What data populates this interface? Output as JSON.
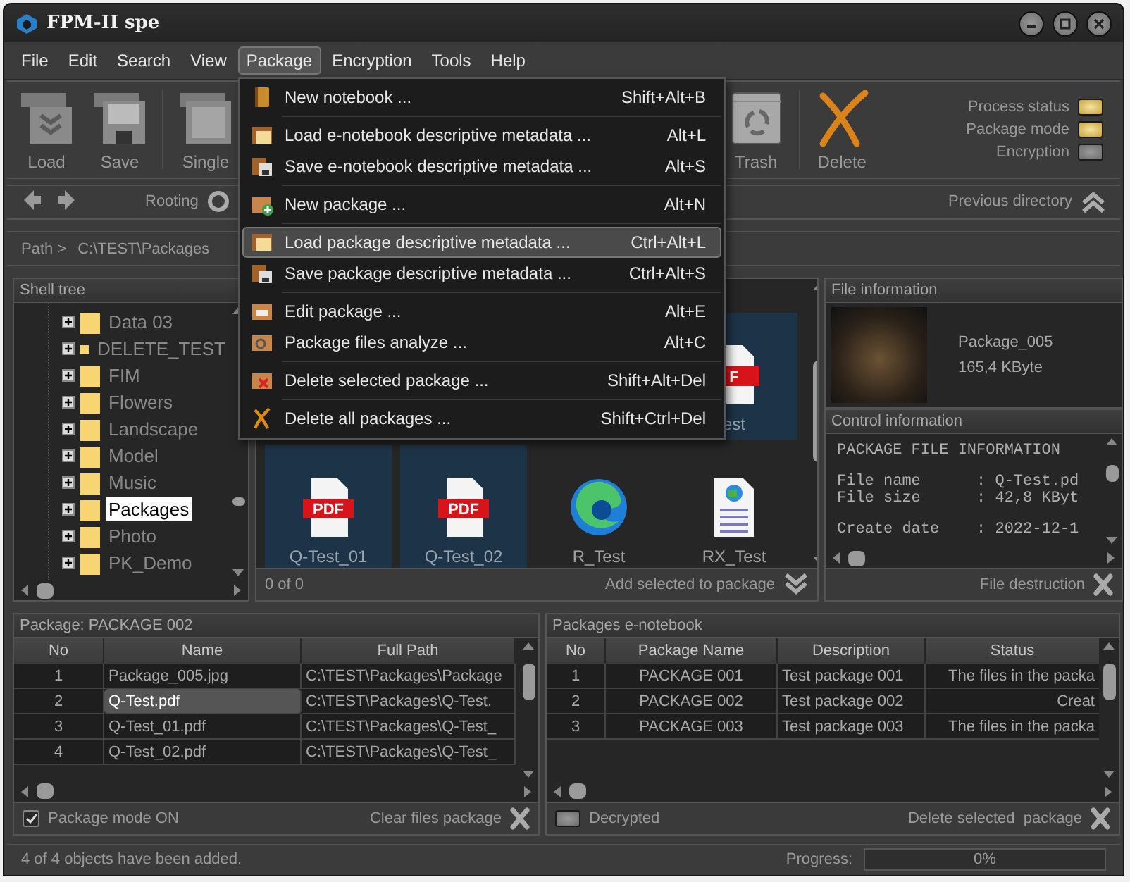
{
  "window": {
    "title": "FPM-II spe"
  },
  "menu_bar": [
    {
      "label": "File",
      "selected": false
    },
    {
      "label": "Edit",
      "selected": false
    },
    {
      "label": "Search",
      "selected": false
    },
    {
      "label": "View",
      "selected": false
    },
    {
      "label": "Package",
      "selected": true
    },
    {
      "label": "Encryption",
      "selected": false
    },
    {
      "label": "Tools",
      "selected": false
    },
    {
      "label": "Help",
      "selected": false
    }
  ],
  "package_menu": [
    {
      "kind": "item",
      "label": "New notebook ...",
      "shortcut": "Shift+Alt+B",
      "selected": false
    },
    {
      "kind": "separator"
    },
    {
      "kind": "item",
      "label": "Load e-notebook descriptive metadata ...",
      "shortcut": "Alt+L",
      "selected": false
    },
    {
      "kind": "item",
      "label": "Save e-notebook descriptive metadata ...",
      "shortcut": "Alt+S",
      "selected": false
    },
    {
      "kind": "separator"
    },
    {
      "kind": "item",
      "label": "New package ...",
      "shortcut": "Alt+N",
      "selected": false
    },
    {
      "kind": "separator"
    },
    {
      "kind": "item",
      "label": "Load package descriptive metadata ...",
      "shortcut": "Ctrl+Alt+L",
      "selected": true
    },
    {
      "kind": "item",
      "label": "Save package descriptive metadata ...",
      "shortcut": "Ctrl+Alt+S",
      "selected": false
    },
    {
      "kind": "separator"
    },
    {
      "kind": "item",
      "label": "Edit package ...",
      "shortcut": "Alt+E",
      "selected": false
    },
    {
      "kind": "item",
      "label": "Package files analyze ...",
      "shortcut": "Alt+C",
      "selected": false
    },
    {
      "kind": "separator"
    },
    {
      "kind": "item",
      "label": "Delete selected package ...",
      "shortcut": "Shift+Alt+Del",
      "selected": false
    },
    {
      "kind": "separator"
    },
    {
      "kind": "item",
      "label": "Delete all packages ...",
      "shortcut": "Shift+Ctrl+Del",
      "selected": false
    }
  ],
  "toolbar": {
    "left": [
      {
        "kind": "load",
        "label": "Load"
      },
      {
        "kind": "save",
        "label": "Save"
      },
      {
        "kind": "single",
        "label": "Single"
      }
    ],
    "right": [
      {
        "kind": "trash",
        "label": "Trash"
      },
      {
        "kind": "delete",
        "label": "Delete"
      }
    ]
  },
  "indicators": [
    {
      "label": "Process status",
      "on": true
    },
    {
      "label": "Package mode",
      "on": true
    },
    {
      "label": "Encryption",
      "on": false
    }
  ],
  "nav": {
    "rooting": "Rooting",
    "previous": "Previous directory"
  },
  "path": {
    "label": "Path >",
    "value": "C:\\TEST\\Packages"
  },
  "shell_tree": {
    "title": "Shell tree",
    "items": [
      {
        "label": "Data 03",
        "expanded": false,
        "selected": false
      },
      {
        "label": "DELETE_TEST",
        "expanded": false,
        "selected": false
      },
      {
        "label": "FIM",
        "expanded": false,
        "selected": false
      },
      {
        "label": "Flowers",
        "expanded": false,
        "selected": false
      },
      {
        "label": "Landscape",
        "expanded": false,
        "selected": false
      },
      {
        "label": "Model",
        "expanded": false,
        "selected": false
      },
      {
        "label": "Music",
        "expanded": false,
        "selected": false
      },
      {
        "label": "Packages",
        "expanded": false,
        "selected": true
      },
      {
        "label": "Photo",
        "expanded": false,
        "selected": false
      },
      {
        "label": "PK_Demo",
        "expanded": false,
        "selected": false
      }
    ]
  },
  "file_view": {
    "items": [
      {
        "kind": "pdf",
        "badge": "F",
        "label": "est",
        "selected": true
      },
      {
        "kind": "pdf",
        "badge": "PDF",
        "label": "Q-Test_01",
        "selected": true
      },
      {
        "kind": "pdf",
        "badge": "PDF",
        "label": "Q-Test_02",
        "selected": true
      },
      {
        "kind": "browser",
        "label": "R_Test",
        "selected": false
      },
      {
        "kind": "web",
        "label": "RX_Test",
        "selected": false
      }
    ],
    "count": "0 of 0",
    "action": "Add selected to package"
  },
  "file_information": {
    "title": "File information",
    "name": "Package_005",
    "size": "165,4 KByte"
  },
  "control_information": {
    "title": "Control information",
    "blocks": [
      [
        "PACKAGE FILE INFORMATION"
      ],
      [
        "File name      : Q-Test.pd",
        "File size      : 42,8 KByt"
      ],
      [
        "Create date    : 2022-12-1"
      ]
    ],
    "action": "File destruction"
  },
  "package_table": {
    "title": "Package: PACKAGE 002",
    "columns": [
      "No",
      "Name",
      "Full Path"
    ],
    "rows": [
      {
        "cells": [
          "1",
          "Package_005.jpg",
          "C:\\TEST\\Packages\\Package"
        ],
        "selected": false
      },
      {
        "cells": [
          "2",
          "Q-Test.pdf",
          "C:\\TEST\\Packages\\Q-Test."
        ],
        "selected": true
      },
      {
        "cells": [
          "3",
          "Q-Test_01.pdf",
          "C:\\TEST\\Packages\\Q-Test_"
        ],
        "selected": false
      },
      {
        "cells": [
          "4",
          "Q-Test_02.pdf",
          "C:\\TEST\\Packages\\Q-Test_"
        ],
        "selected": false
      }
    ],
    "mode": {
      "label": "Package mode ON",
      "checked": true
    },
    "action": "Clear files package"
  },
  "notebook_table": {
    "title": "Packages e-notebook",
    "columns": [
      "No",
      "Package Name",
      "Description",
      "Status"
    ],
    "rows": [
      {
        "cells": [
          "1",
          "PACKAGE 001",
          "Test package 001",
          "The files in the packa"
        ],
        "selected": false
      },
      {
        "cells": [
          "2",
          "PACKAGE 002",
          "Test package 002",
          "Creat"
        ],
        "selected": false
      },
      {
        "cells": [
          "3",
          "PACKAGE 003",
          "Test package 003",
          "The files in the packa"
        ],
        "selected": false
      }
    ],
    "decrypted": {
      "label": "Decrypted",
      "on": false
    },
    "action": "Delete selected  package"
  },
  "status_bar": {
    "message": "4 of 4 objects have been added.",
    "progress_label": "Progress:",
    "progress": {
      "level": 0,
      "reading": "0%"
    }
  }
}
